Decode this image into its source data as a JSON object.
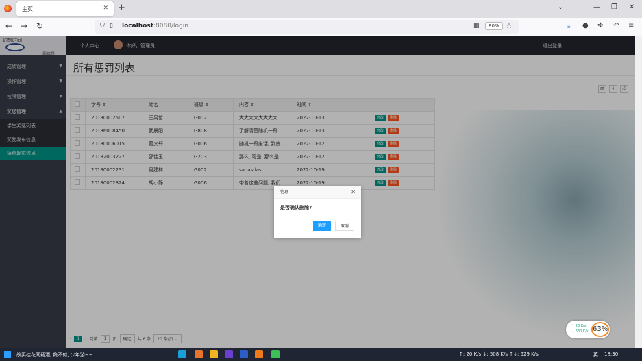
{
  "browser": {
    "tab_title": "主页",
    "url_host": "localhost",
    "url_rest": ":8080/login",
    "zoom": "80%"
  },
  "app": {
    "logo_text": "幻想时间",
    "logo_sub": "霸莽是",
    "topnav_personal": "个人中心",
    "greeting": "你好，管理员",
    "logout": "退出登录"
  },
  "sidebar": {
    "groups": [
      {
        "label": "成绩管理"
      },
      {
        "label": "操作管理"
      },
      {
        "label": "权限管理"
      },
      {
        "label": "奖惩管理"
      }
    ],
    "subitems": [
      {
        "label": "学生奖惩列表"
      },
      {
        "label": "奖励发布信息"
      },
      {
        "label": "惩罚发布信息"
      }
    ]
  },
  "page": {
    "title": "所有惩罚列表"
  },
  "table": {
    "columns": [
      "学号 ⇕",
      "姓名",
      "班级 ⇕",
      "内容 ⇕",
      "时间 ⇕"
    ],
    "edit_label": "修改",
    "delete_label": "删除",
    "rows": [
      [
        "20180002507",
        "王禹哲",
        "G002",
        "大大大大大大大大...",
        "2022-10-13"
      ],
      [
        "20186008450",
        "武晨阳",
        "G808",
        "了解清楚随机一段...",
        "2022-10-13"
      ],
      [
        "20180006015",
        "葛文轩",
        "G006",
        "随机一段废话, 到底...",
        "2022-10-12"
      ],
      [
        "20182003227",
        "邵佳玉",
        "G203",
        "那么, 可是, 那么是...",
        "2022-10-12"
      ],
      [
        "20180002231",
        "吴建林",
        "G002",
        "sadasdas",
        "2022-10-19"
      ],
      [
        "20180002824",
        "胡小静",
        "G006",
        "带着这些问题, 我们...",
        "2022-10-19"
      ]
    ]
  },
  "pager": {
    "current": "1",
    "goto_label": "到第",
    "page_input": "1",
    "page_unit": "页",
    "confirm": "确定",
    "total": "共 6 条",
    "per_page": "20 条/页"
  },
  "dialog": {
    "title": "信息",
    "message": "是否确认删除?",
    "ok": "确定",
    "cancel": "取消"
  },
  "speed_widget": {
    "up": "↑ 23 K/s",
    "down": "↓ 630 K/s",
    "percent": "63%"
  },
  "taskbar": {
    "text": "故买桂花同载酒, 终不似, 少年游~~",
    "net": "↑: 20 K/s  ↓: 508 K/s  ↑↓: 529 K/s",
    "lang": "英",
    "time": "18:30"
  }
}
